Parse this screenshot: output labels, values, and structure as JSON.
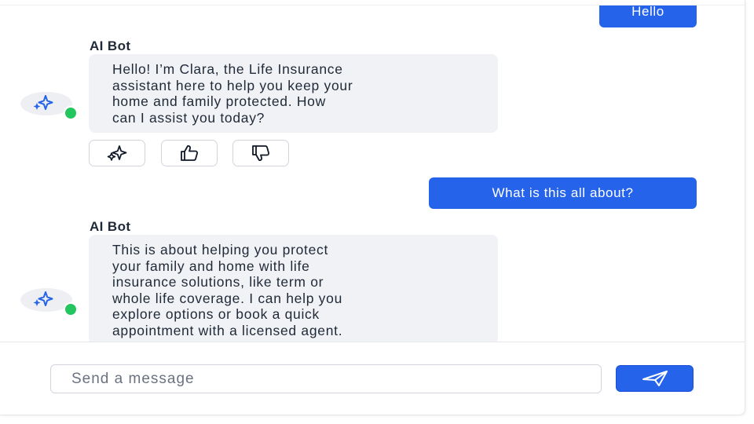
{
  "chat": {
    "previous_user_message": "Hello",
    "bot_name": "AI Bot",
    "messages": [
      {
        "role": "bot",
        "name": "AI Bot",
        "lines": [
          "Hello! I’m Clara, the Life Insurance",
          "assistant here to help you keep your",
          "home and family protected. How",
          "can I assist you today?"
        ]
      },
      {
        "role": "user",
        "text": "What is this all about?"
      },
      {
        "role": "bot",
        "name": "AI Bot",
        "lines": [
          "This is about helping you protect",
          "your family and home with life",
          "insurance solutions, like term or",
          "whole life coverage. I can help you",
          "explore options or book a quick",
          "appointment with a licensed agent."
        ]
      }
    ],
    "message_actions": [
      "sparkles-icon",
      "thumbs-up-icon",
      "thumbs-down-icon"
    ]
  },
  "composer": {
    "placeholder": "Send a message",
    "value": "",
    "send_icon": "send-icon"
  },
  "colors": {
    "accent": "#2563eb",
    "online": "#22c55e",
    "bot_bubble": "#f1f2f5",
    "avatar_icon": "#2563eb"
  }
}
